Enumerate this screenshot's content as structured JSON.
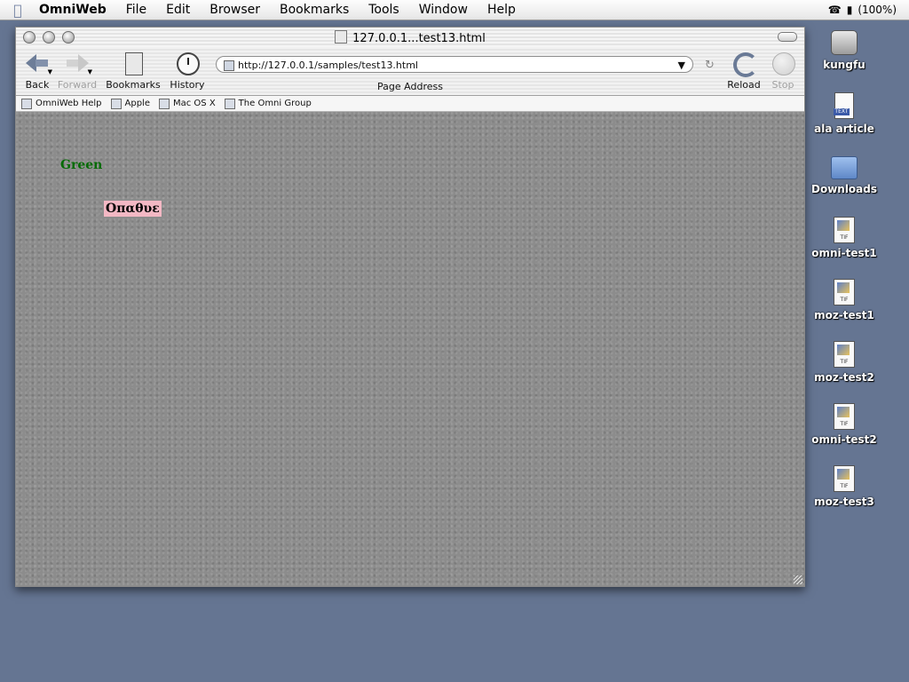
{
  "menubar": {
    "apple": "",
    "app": "OmniWeb",
    "items": [
      "File",
      "Edit",
      "Browser",
      "Bookmarks",
      "Tools",
      "Window",
      "Help"
    ],
    "battery": "(100%)"
  },
  "window": {
    "title": "127.0.0.1...test13.html",
    "toolbar": {
      "back": "Back",
      "forward": "Forward",
      "bookmarks": "Bookmarks",
      "history": "History",
      "address": "http://127.0.0.1/samples/test13.html",
      "address_label": "Page Address",
      "reload": "Reload",
      "stop": "Stop"
    },
    "bookmarks_bar": [
      "OmniWeb Help",
      "Apple",
      "Mac OS X",
      "The Omni Group"
    ],
    "page": {
      "green_text": "Green",
      "greek_text": "Οπαθυε"
    }
  },
  "desktop_icons": [
    "kungfu",
    "ala article",
    "Downloads",
    "omni-test1",
    "moz-test1",
    "moz-test2",
    "omni-test2",
    "moz-test3"
  ],
  "colors": {
    "desktop": "#657592",
    "green_text": "#056b05",
    "greek_highlight": "#f3b8c4"
  }
}
